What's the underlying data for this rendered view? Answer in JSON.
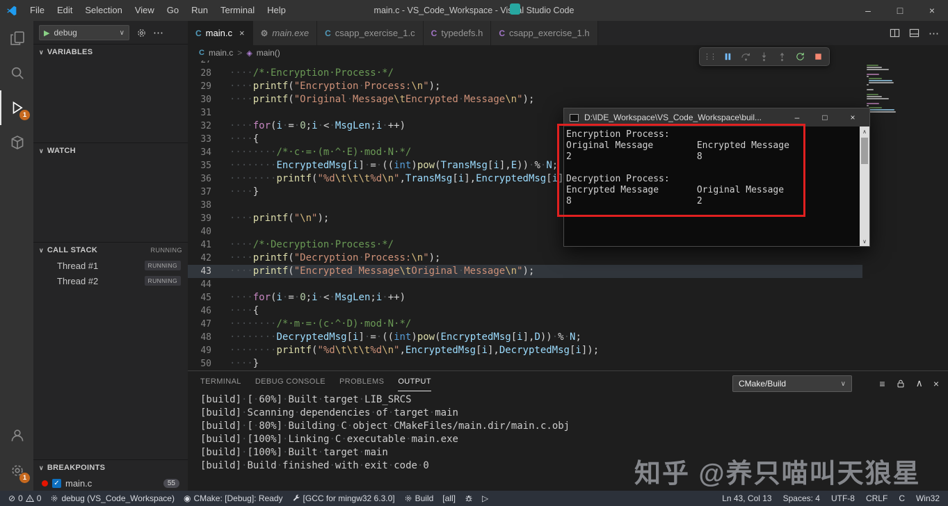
{
  "glyphs": {
    "play": "▶",
    "play_outline": "▷",
    "chevron_down": "∨",
    "chevron_up": "∧",
    "more": "⋯",
    "close": "×",
    "minimize": "–",
    "maximize": "□",
    "check": "✓",
    "grip": "⋮⋮",
    "breadcrumb_sep": ">",
    "lines": "≡",
    "error": "⊘",
    "cmake": "◉"
  },
  "titlebar": {
    "menus": [
      "File",
      "Edit",
      "Selection",
      "View",
      "Go",
      "Run",
      "Terminal",
      "Help"
    ],
    "title": "main.c - VS_Code_Workspace - Visual Studio Code"
  },
  "activitybar": {
    "items": [
      {
        "id": "explorer",
        "svg": "files"
      },
      {
        "id": "search",
        "svg": "search"
      },
      {
        "id": "run-debug",
        "svg": "debug",
        "active": true,
        "badge": "1"
      },
      {
        "id": "extensions",
        "svg": "box"
      }
    ],
    "bottom": [
      {
        "id": "accounts",
        "svg": "account"
      },
      {
        "id": "manage",
        "svg": "gear",
        "badge": "1"
      }
    ]
  },
  "sidebar": {
    "config_label": "debug",
    "sections": {
      "variables": "VARIABLES",
      "watch": "WATCH",
      "callstack": "CALL STACK",
      "callstack_state": "RUNNING",
      "breakpoints": "BREAKPOINTS"
    },
    "threads": [
      {
        "name": "Thread #1",
        "state": "RUNNING"
      },
      {
        "name": "Thread #2",
        "state": "RUNNING"
      }
    ],
    "breakpoint": {
      "file": "main.c",
      "line": "55"
    }
  },
  "tabs": [
    {
      "label": "main.c",
      "icon": "C",
      "icon_color": "#519aba",
      "active": true
    },
    {
      "label": "main.exe",
      "icon": "⚙",
      "icon_color": "#8d8d8d",
      "italic": true
    },
    {
      "label": "csapp_exercise_1.c",
      "icon": "C",
      "icon_color": "#519aba"
    },
    {
      "label": "typedefs.h",
      "icon": "C",
      "icon_color": "#a074c4"
    },
    {
      "label": "csapp_exercise_1.h",
      "icon": "C",
      "icon_color": "#a074c4"
    }
  ],
  "breadcrumbs": {
    "file": "main.c",
    "symbol": "main()"
  },
  "editor": {
    "current_line": 43,
    "lines": [
      {
        "n": 27,
        "t": []
      },
      {
        "n": 28,
        "t": [
          [
            "w",
            "····"
          ],
          [
            "c",
            "/*·Encryption·Process·*/"
          ]
        ]
      },
      {
        "n": 29,
        "t": [
          [
            "w",
            "····"
          ],
          [
            "f",
            "printf"
          ],
          [
            "p",
            "("
          ],
          [
            "s",
            "\"Encryption"
          ],
          [
            "w",
            "·"
          ],
          [
            "s",
            "Process:"
          ],
          [
            "e",
            "\\n"
          ],
          [
            "s",
            "\""
          ],
          [
            "p",
            ");"
          ]
        ]
      },
      {
        "n": 30,
        "t": [
          [
            "w",
            "····"
          ],
          [
            "f",
            "printf"
          ],
          [
            "p",
            "("
          ],
          [
            "s",
            "\"Original"
          ],
          [
            "w",
            "·"
          ],
          [
            "s",
            "Message"
          ],
          [
            "e",
            "\\t"
          ],
          [
            "s",
            "Encrypted"
          ],
          [
            "w",
            "·"
          ],
          [
            "s",
            "Message"
          ],
          [
            "e",
            "\\n"
          ],
          [
            "s",
            "\""
          ],
          [
            "p",
            ");"
          ]
        ]
      },
      {
        "n": 31,
        "t": []
      },
      {
        "n": 32,
        "t": [
          [
            "w",
            "····"
          ],
          [
            "k",
            "for"
          ],
          [
            "p",
            "("
          ],
          [
            "v",
            "i"
          ],
          [
            "w",
            "·"
          ],
          [
            "o",
            "="
          ],
          [
            "w",
            "·"
          ],
          [
            "n",
            "0"
          ],
          [
            "p",
            ";"
          ],
          [
            "v",
            "i"
          ],
          [
            "w",
            "·"
          ],
          [
            "o",
            "<"
          ],
          [
            "w",
            "·"
          ],
          [
            "v",
            "MsgLen"
          ],
          [
            "p",
            ";"
          ],
          [
            "v",
            "i"
          ],
          [
            "w",
            "·"
          ],
          [
            "o",
            "++"
          ],
          [
            "p",
            ")"
          ]
        ]
      },
      {
        "n": 33,
        "t": [
          [
            "w",
            "····"
          ],
          [
            "p",
            "{"
          ]
        ]
      },
      {
        "n": 34,
        "t": [
          [
            "w",
            "········"
          ],
          [
            "c",
            "/*·c·=·(m·^·E)·mod·N·*/"
          ]
        ]
      },
      {
        "n": 35,
        "t": [
          [
            "w",
            "········"
          ],
          [
            "v",
            "EncryptedMsg"
          ],
          [
            "p",
            "["
          ],
          [
            "v",
            "i"
          ],
          [
            "p",
            "]"
          ],
          [
            "w",
            "·"
          ],
          [
            "o",
            "="
          ],
          [
            "w",
            "·"
          ],
          [
            "p",
            "(("
          ],
          [
            "t",
            "int"
          ],
          [
            "p",
            ")"
          ],
          [
            "f",
            "pow"
          ],
          [
            "p",
            "("
          ],
          [
            "v",
            "TransMsg"
          ],
          [
            "p",
            "["
          ],
          [
            "v",
            "i"
          ],
          [
            "p",
            "],"
          ],
          [
            "v",
            "E"
          ],
          [
            "p",
            "))"
          ],
          [
            "w",
            "·"
          ],
          [
            "o",
            "%"
          ],
          [
            "w",
            "·"
          ],
          [
            "v",
            "N"
          ],
          [
            "p",
            ";"
          ]
        ]
      },
      {
        "n": 36,
        "t": [
          [
            "w",
            "········"
          ],
          [
            "f",
            "printf"
          ],
          [
            "p",
            "("
          ],
          [
            "s",
            "\"%d"
          ],
          [
            "e",
            "\\t\\t\\t"
          ],
          [
            "s",
            "%d"
          ],
          [
            "e",
            "\\n"
          ],
          [
            "s",
            "\""
          ],
          [
            "p",
            ","
          ],
          [
            "v",
            "TransMsg"
          ],
          [
            "p",
            "["
          ],
          [
            "v",
            "i"
          ],
          [
            "p",
            "],"
          ],
          [
            "v",
            "EncryptedMsg"
          ],
          [
            "p",
            "["
          ],
          [
            "v",
            "i"
          ],
          [
            "p",
            "]);"
          ]
        ]
      },
      {
        "n": 37,
        "t": [
          [
            "w",
            "····"
          ],
          [
            "p",
            "}"
          ]
        ]
      },
      {
        "n": 38,
        "t": []
      },
      {
        "n": 39,
        "t": [
          [
            "w",
            "····"
          ],
          [
            "f",
            "printf"
          ],
          [
            "p",
            "("
          ],
          [
            "s",
            "\""
          ],
          [
            "e",
            "\\n"
          ],
          [
            "s",
            "\""
          ],
          [
            "p",
            ");"
          ]
        ]
      },
      {
        "n": 40,
        "t": []
      },
      {
        "n": 41,
        "t": [
          [
            "w",
            "····"
          ],
          [
            "c",
            "/*·Decryption·Process·*/"
          ]
        ]
      },
      {
        "n": 42,
        "t": [
          [
            "w",
            "····"
          ],
          [
            "f",
            "printf"
          ],
          [
            "p",
            "("
          ],
          [
            "s",
            "\"Decryption"
          ],
          [
            "w",
            "·"
          ],
          [
            "s",
            "Process:"
          ],
          [
            "e",
            "\\n"
          ],
          [
            "s",
            "\""
          ],
          [
            "p",
            ");"
          ]
        ]
      },
      {
        "n": 43,
        "t": [
          [
            "w",
            "····"
          ],
          [
            "f",
            "printf"
          ],
          [
            "p",
            "("
          ],
          [
            "s",
            "\"Encrypted"
          ],
          [
            "w",
            "·"
          ],
          [
            "s",
            "Message"
          ],
          [
            "e",
            "\\t"
          ],
          [
            "s",
            "Original"
          ],
          [
            "w",
            "·"
          ],
          [
            "s",
            "Message"
          ],
          [
            "e",
            "\\n"
          ],
          [
            "s",
            "\""
          ],
          [
            "p",
            ");"
          ]
        ]
      },
      {
        "n": 44,
        "t": []
      },
      {
        "n": 45,
        "t": [
          [
            "w",
            "····"
          ],
          [
            "k",
            "for"
          ],
          [
            "p",
            "("
          ],
          [
            "v",
            "i"
          ],
          [
            "w",
            "·"
          ],
          [
            "o",
            "="
          ],
          [
            "w",
            "·"
          ],
          [
            "n",
            "0"
          ],
          [
            "p",
            ";"
          ],
          [
            "v",
            "i"
          ],
          [
            "w",
            "·"
          ],
          [
            "o",
            "<"
          ],
          [
            "w",
            "·"
          ],
          [
            "v",
            "MsgLen"
          ],
          [
            "p",
            ";"
          ],
          [
            "v",
            "i"
          ],
          [
            "w",
            "·"
          ],
          [
            "o",
            "++"
          ],
          [
            "p",
            ")"
          ]
        ]
      },
      {
        "n": 46,
        "t": [
          [
            "w",
            "····"
          ],
          [
            "p",
            "{"
          ]
        ]
      },
      {
        "n": 47,
        "t": [
          [
            "w",
            "········"
          ],
          [
            "c",
            "/*·m·=·(c·^·D)·mod·N·*/"
          ]
        ]
      },
      {
        "n": 48,
        "t": [
          [
            "w",
            "········"
          ],
          [
            "v",
            "DecryptedMsg"
          ],
          [
            "p",
            "["
          ],
          [
            "v",
            "i"
          ],
          [
            "p",
            "]"
          ],
          [
            "w",
            "·"
          ],
          [
            "o",
            "="
          ],
          [
            "w",
            "·"
          ],
          [
            "p",
            "(("
          ],
          [
            "t",
            "int"
          ],
          [
            "p",
            ")"
          ],
          [
            "f",
            "pow"
          ],
          [
            "p",
            "("
          ],
          [
            "v",
            "EncryptedMsg"
          ],
          [
            "p",
            "["
          ],
          [
            "v",
            "i"
          ],
          [
            "p",
            "],"
          ],
          [
            "v",
            "D"
          ],
          [
            "p",
            "))"
          ],
          [
            "w",
            "·"
          ],
          [
            "o",
            "%"
          ],
          [
            "w",
            "·"
          ],
          [
            "v",
            "N"
          ],
          [
            "p",
            ";"
          ]
        ]
      },
      {
        "n": 49,
        "t": [
          [
            "w",
            "········"
          ],
          [
            "f",
            "printf"
          ],
          [
            "p",
            "("
          ],
          [
            "s",
            "\"%d"
          ],
          [
            "e",
            "\\t\\t\\t"
          ],
          [
            "s",
            "%d"
          ],
          [
            "e",
            "\\n"
          ],
          [
            "s",
            "\""
          ],
          [
            "p",
            ","
          ],
          [
            "v",
            "EncryptedMsg"
          ],
          [
            "p",
            "["
          ],
          [
            "v",
            "i"
          ],
          [
            "p",
            "],"
          ],
          [
            "v",
            "DecryptedMsg"
          ],
          [
            "p",
            "["
          ],
          [
            "v",
            "i"
          ],
          [
            "p",
            "]);"
          ]
        ]
      },
      {
        "n": 50,
        "t": [
          [
            "w",
            "····"
          ],
          [
            "p",
            "}"
          ]
        ]
      }
    ]
  },
  "console": {
    "title": "D:\\IDE_Workspace\\VS_Code_Workspace\\buil...",
    "lines": [
      "Encryption Process:",
      "Original Message        Encrypted Message",
      "2                       8",
      "",
      "Decryption Process:",
      "Encrypted Message       Original Message",
      "8                       2"
    ]
  },
  "panel": {
    "tabs": [
      "TERMINAL",
      "DEBUG CONSOLE",
      "PROBLEMS",
      "OUTPUT"
    ],
    "active_tab": "OUTPUT",
    "channel": "CMake/Build",
    "output": [
      "[build]·[·60%]·Built·target·LIB_SRCS",
      "[build]·Scanning·dependencies·of·target·main",
      "[build]·[·80%]·Building·C·object·CMakeFiles/main.dir/main.c.obj",
      "[build]·[100%]·Linking·C·executable·main.exe",
      "[build]·[100%]·Built·target·main",
      "[build]·Build·finished·with·exit·code·0"
    ]
  },
  "statusbar": {
    "left": [
      {
        "name": "problems",
        "parts": [
          {
            "glyph": "⊘",
            "gname": "error-icon"
          },
          {
            "text": "0"
          },
          {
            "svg": "warn",
            "gname": "warning-icon"
          },
          {
            "text": "0"
          }
        ]
      },
      {
        "name": "debug-config",
        "parts": [
          {
            "svg": "gear",
            "gname": "gear-icon"
          },
          {
            "text": "debug (VS_Code_Workspace)"
          }
        ]
      },
      {
        "name": "cmake-status",
        "parts": [
          {
            "glyph": "◉",
            "gname": "cmake-icon"
          },
          {
            "text": "CMake: [Debug]: Ready"
          }
        ]
      },
      {
        "name": "kit",
        "parts": [
          {
            "svg": "wrench",
            "gname": "wrench-icon"
          },
          {
            "text": "[GCC for mingw32 6.3.0]"
          }
        ]
      },
      {
        "name": "build-button",
        "parts": [
          {
            "svg": "gear",
            "gname": "gear-icon"
          },
          {
            "text": "Build"
          }
        ]
      },
      {
        "name": "build-target",
        "parts": [
          {
            "text": "[all]"
          }
        ]
      },
      {
        "name": "debug-button",
        "parts": [
          {
            "svg": "bug",
            "gname": "bug-icon"
          }
        ]
      },
      {
        "name": "launch-button",
        "parts": [
          {
            "glyph": "▷",
            "gname": "play-outline-icon"
          }
        ]
      }
    ],
    "right": [
      {
        "name": "cursor-position",
        "parts": [
          {
            "text": "Ln 43, Col 13"
          }
        ]
      },
      {
        "name": "indentation",
        "parts": [
          {
            "text": "Spaces: 4"
          }
        ]
      },
      {
        "name": "encoding",
        "parts": [
          {
            "text": "UTF-8"
          }
        ]
      },
      {
        "name": "eol",
        "parts": [
          {
            "text": "CRLF"
          }
        ]
      },
      {
        "name": "language",
        "parts": [
          {
            "text": "C"
          }
        ]
      },
      {
        "name": "platform",
        "parts": [
          {
            "text": "Win32"
          }
        ]
      }
    ]
  },
  "watermark": "知乎 @养只喵叫天狼星"
}
